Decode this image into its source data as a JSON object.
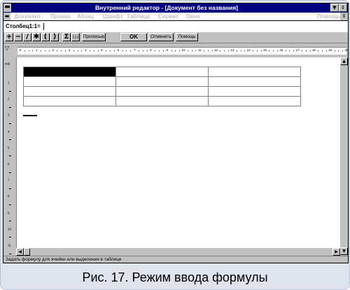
{
  "window": {
    "title": "Внутренний редактор - [Документ без названия]",
    "system_menu_icon": "minus-icon",
    "scroll_down_icon": "triangle-down-icon",
    "restore_icon": "restore-icon"
  },
  "menu": {
    "items": [
      "Документ",
      "Правка",
      "Абзац",
      "Шрифт",
      "Таблица",
      "Сервис",
      "Окна"
    ],
    "help": "Помощь"
  },
  "formula_bar": {
    "value": "Столбец1:1="
  },
  "toolbar": {
    "ops": [
      "+",
      "−",
      "/",
      "✱",
      "(",
      ")"
    ],
    "sum_label": "Σ",
    "bars_label": "|.|.|",
    "words_label": "Прописью",
    "ok_label": "OK",
    "cancel_label": "Отменить",
    "help_label": "Помощь"
  },
  "ruler": {
    "numbers": [
      "0",
      "1",
      "2",
      "3",
      "4",
      "5",
      "6",
      "7",
      "8",
      "9",
      "10",
      "11",
      "12",
      "13",
      "14",
      "15",
      "16",
      "17",
      "18",
      "19",
      "20"
    ]
  },
  "left_ruler": {
    "numbers": [
      "1",
      "2",
      "3",
      "4",
      "5",
      "6",
      "7",
      "8",
      "9",
      "10",
      "11"
    ]
  },
  "status": {
    "text": "Задать формулу для ячейки или выделения в таблице"
  },
  "caption": {
    "text": "Рис. 17. Режим ввода формулы"
  }
}
